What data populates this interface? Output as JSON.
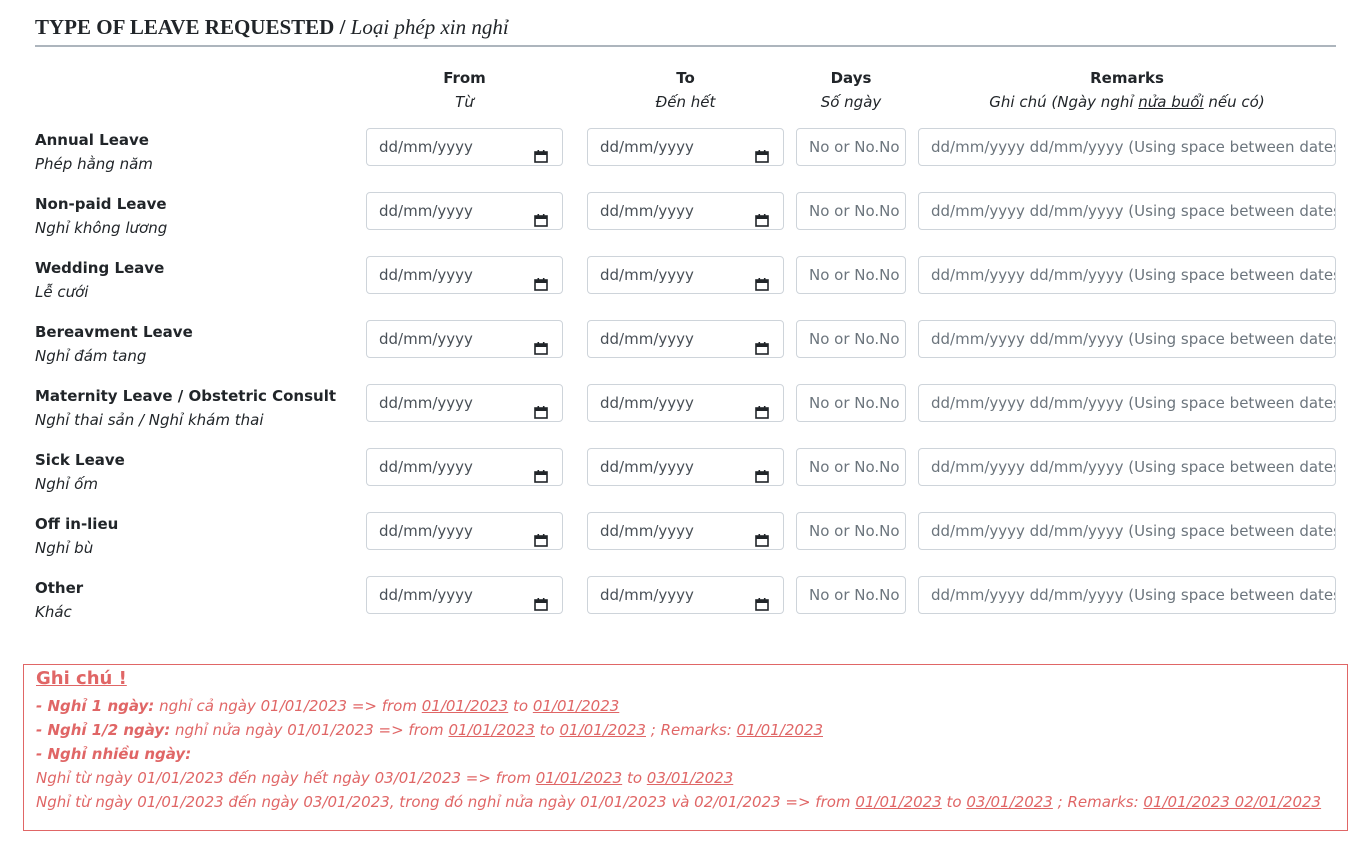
{
  "section": {
    "title_en": "TYPE OF LEAVE REQUESTED /",
    "title_vi": "Loại phép xin nghỉ"
  },
  "columns": {
    "from": {
      "en": "From",
      "vi": "Từ"
    },
    "to": {
      "en": "To",
      "vi": "Đến hết"
    },
    "days": {
      "en": "Days",
      "vi": "Số ngày"
    },
    "remarks": {
      "en": "Remarks",
      "vi_prefix": "Ghi chú (Ngày nghỉ ",
      "vi_underline": "nửa buổi",
      "vi_suffix": " nếu có)"
    }
  },
  "placeholders": {
    "date": "dd/mm/yyyy",
    "days": "No or No.No",
    "remarks": "dd/mm/yyyy dd/mm/yyyy (Using space between dates)"
  },
  "rows": [
    {
      "en": "Annual Leave",
      "vi": "Phép hằng năm"
    },
    {
      "en": "Non-paid Leave",
      "vi": "Nghỉ không lương"
    },
    {
      "en": "Wedding Leave",
      "vi": "Lễ cưới"
    },
    {
      "en": "Bereavment Leave",
      "vi": "Nghỉ đám tang"
    },
    {
      "en": "Maternity Leave / Obstetric Consult",
      "vi": "Nghỉ thai sản / Nghỉ khám thai"
    },
    {
      "en": "Sick Leave",
      "vi": "Nghỉ ốm"
    },
    {
      "en": "Off in-lieu",
      "vi": "Nghỉ bù"
    },
    {
      "en": "Other",
      "vi": "Khác"
    }
  ],
  "note": {
    "title": "Ghi chú !",
    "line1": {
      "bold": "- Nghỉ 1 ngày:",
      "text": " nghỉ cả ngày 01/01/2023 => from ",
      "from": "01/01/2023",
      "mid": " to ",
      "to": "01/01/2023"
    },
    "line2": {
      "bold": "- Nghỉ 1/2 ngày:",
      "text": " nghỉ nửa ngày 01/01/2023 => from ",
      "from": "01/01/2023",
      "mid": " to ",
      "to": "01/01/2023",
      "rem_label": " ; Remarks: ",
      "rem": "01/01/2023"
    },
    "line3": {
      "bold": "- Nghỉ nhiều ngày:"
    },
    "line4": {
      "text": "Nghỉ từ ngày 01/01/2023 đến ngày hết ngày 03/01/2023 => from ",
      "from": "01/01/2023",
      "mid": " to ",
      "to": "03/01/2023"
    },
    "line5": {
      "text": "Nghỉ từ ngày 01/01/2023 đến ngày 03/01/2023, trong đó nghỉ nửa ngày 01/01/2023 và 02/01/2023 => from ",
      "from": "01/01/2023",
      "mid": " to ",
      "to": "03/01/2023",
      "rem_label": " ; Remarks: ",
      "rem": "01/01/2023 02/01/2023"
    }
  }
}
